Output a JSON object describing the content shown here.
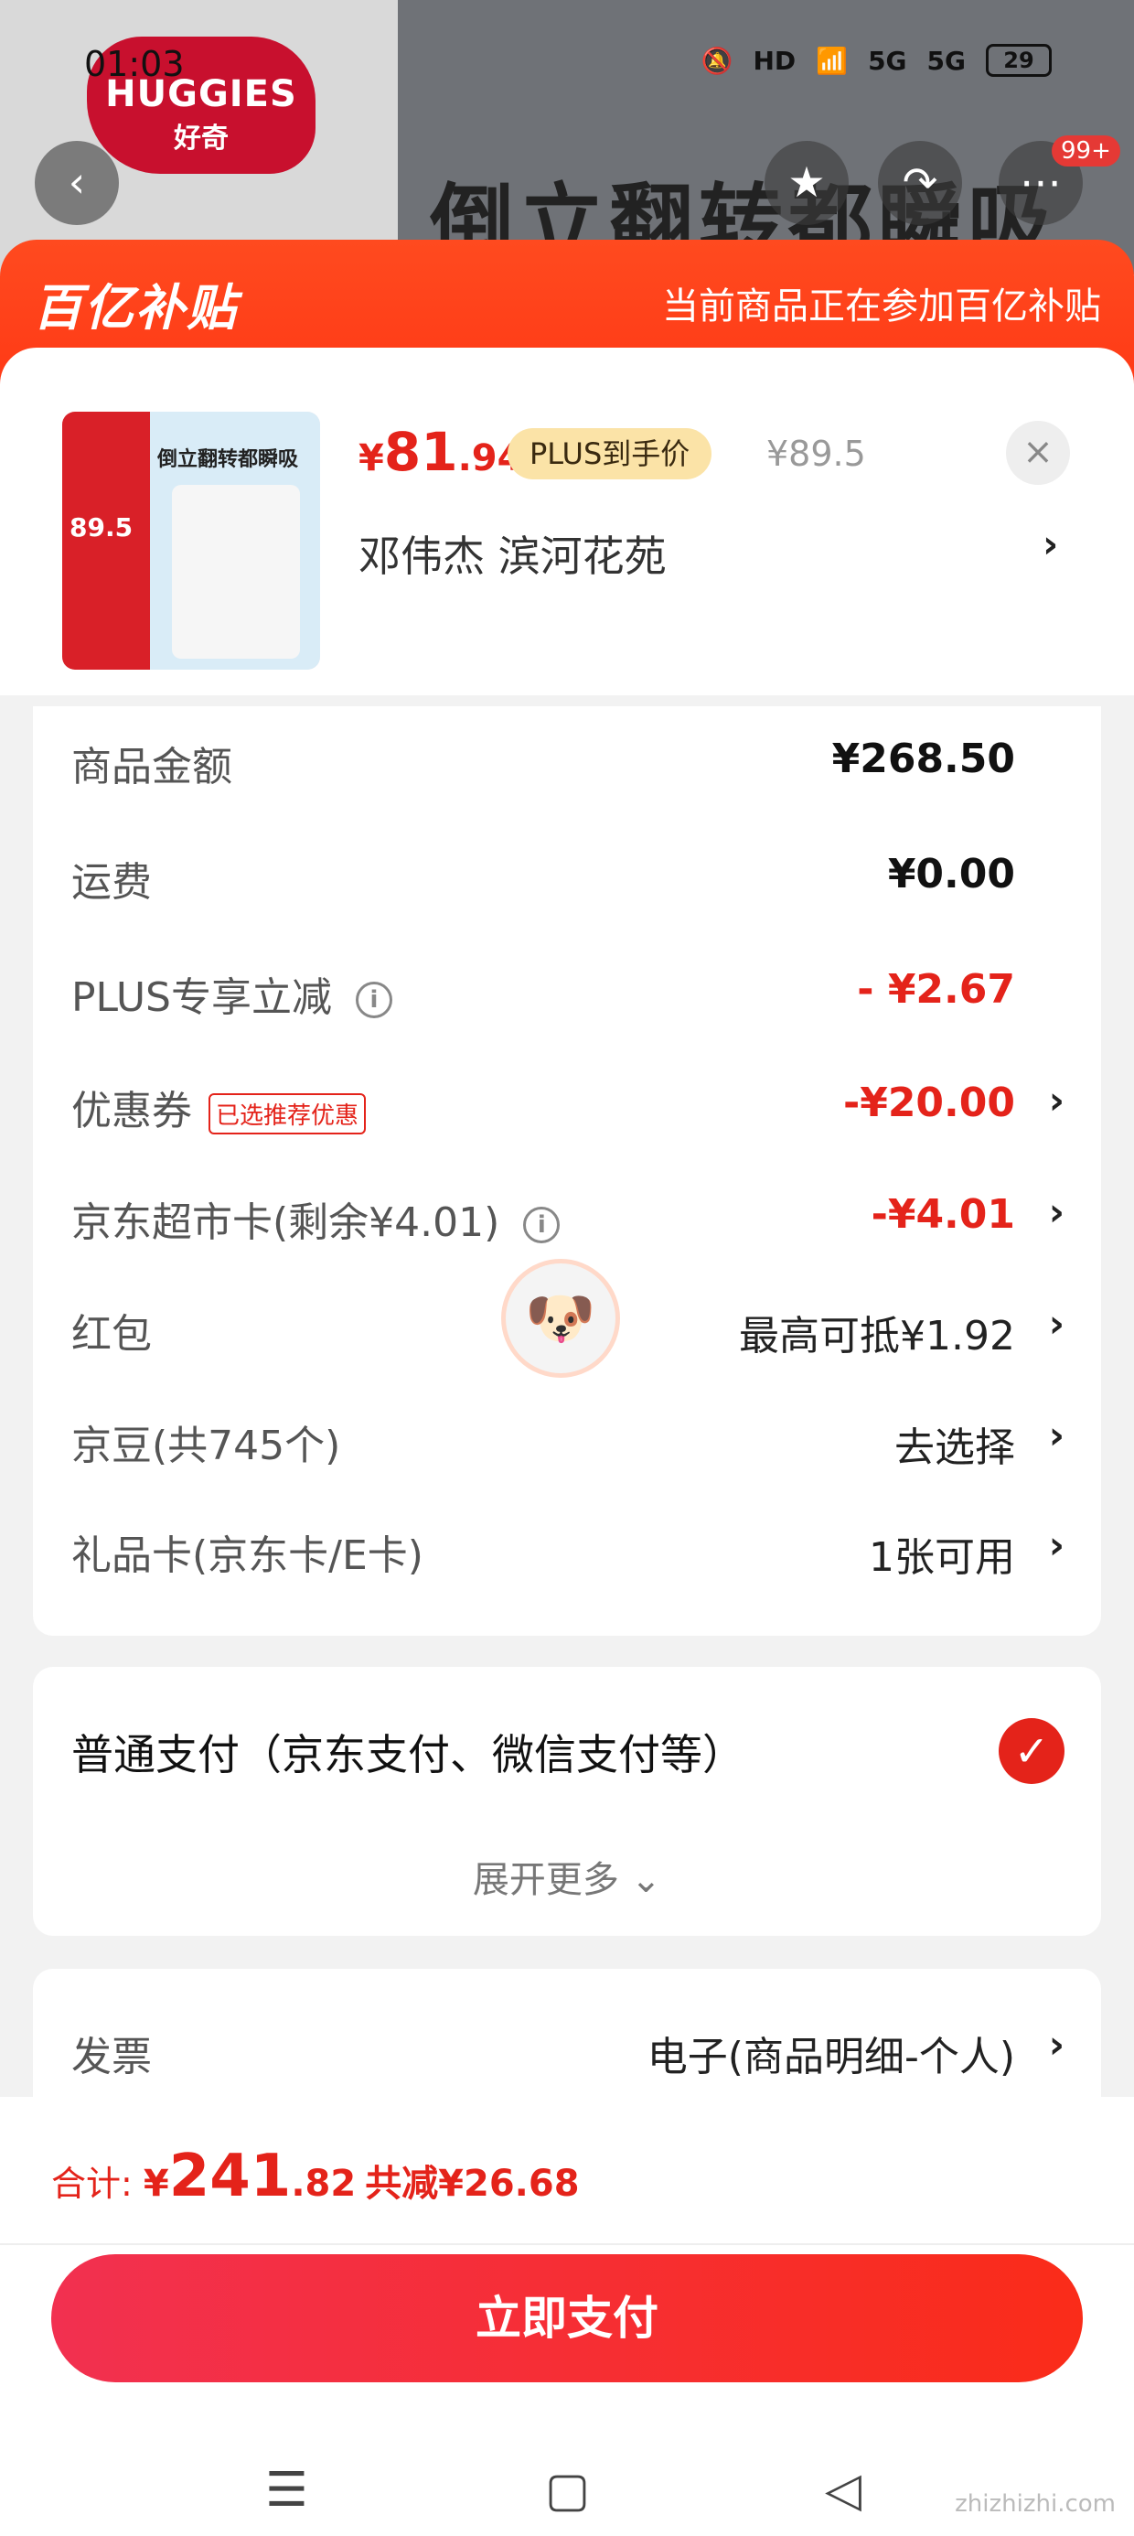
{
  "status": {
    "time": "01:03",
    "indicators": [
      "HD",
      "5G",
      "5G"
    ],
    "battery": "29"
  },
  "background": {
    "brand_name": "HUGGIES",
    "brand_cn": "好奇",
    "banner_text": "倒立翻转都瞬吸",
    "badge": "99+"
  },
  "subsidy": {
    "logo": "百亿补贴",
    "note": "当前商品正在参加百亿补贴"
  },
  "product": {
    "thumb_title": "倒立翻转都瞬吸",
    "thumb_price": "89.5",
    "price_symbol": "¥",
    "price_int": "81",
    "price_dec": ".94",
    "plus_tag": "PLUS到手价",
    "old_price": "¥89.5",
    "address": "邓伟杰  滨河花苑"
  },
  "costs": [
    {
      "label": "商品金额",
      "value": "¥268.50",
      "style": "black",
      "chevron": false
    },
    {
      "label": "运费",
      "value": "¥0.00",
      "style": "black",
      "chevron": false
    },
    {
      "label": "PLUS专享立减",
      "value": "- ¥2.67",
      "style": "red",
      "chevron": false,
      "info": true
    },
    {
      "label": "优惠券",
      "value": "-¥20.00",
      "style": "red",
      "chevron": true,
      "tag": "已选推荐优惠"
    },
    {
      "label": "京东超市卡(剩余¥4.01)",
      "value": "-¥4.01",
      "style": "red",
      "chevron": true,
      "info": true
    },
    {
      "label": "红包",
      "value": "最高可抵¥1.92",
      "style": "norm",
      "chevron": true
    },
    {
      "label": "京豆(共745个)",
      "value": "去选择",
      "style": "norm",
      "chevron": true
    },
    {
      "label": "礼品卡(京东卡/E卡)",
      "value": "1张可用",
      "style": "norm",
      "chevron": true
    }
  ],
  "payment": {
    "method": "普通支付（京东支付、微信支付等）",
    "expand": "展开更多"
  },
  "invoice": {
    "label": "发票",
    "value": "电子(商品明细-个人)"
  },
  "total": {
    "label": "合计: ",
    "symbol": "¥",
    "int": "241",
    "dec": ".82",
    "saving": "共减¥26.68"
  },
  "pay_button": "立即支付",
  "watermark": "zhizhizhi.com",
  "colors": {
    "accent": "#e4231a",
    "subsidy": "#ff4a1f",
    "plus_tag": "#fbe3a7"
  }
}
